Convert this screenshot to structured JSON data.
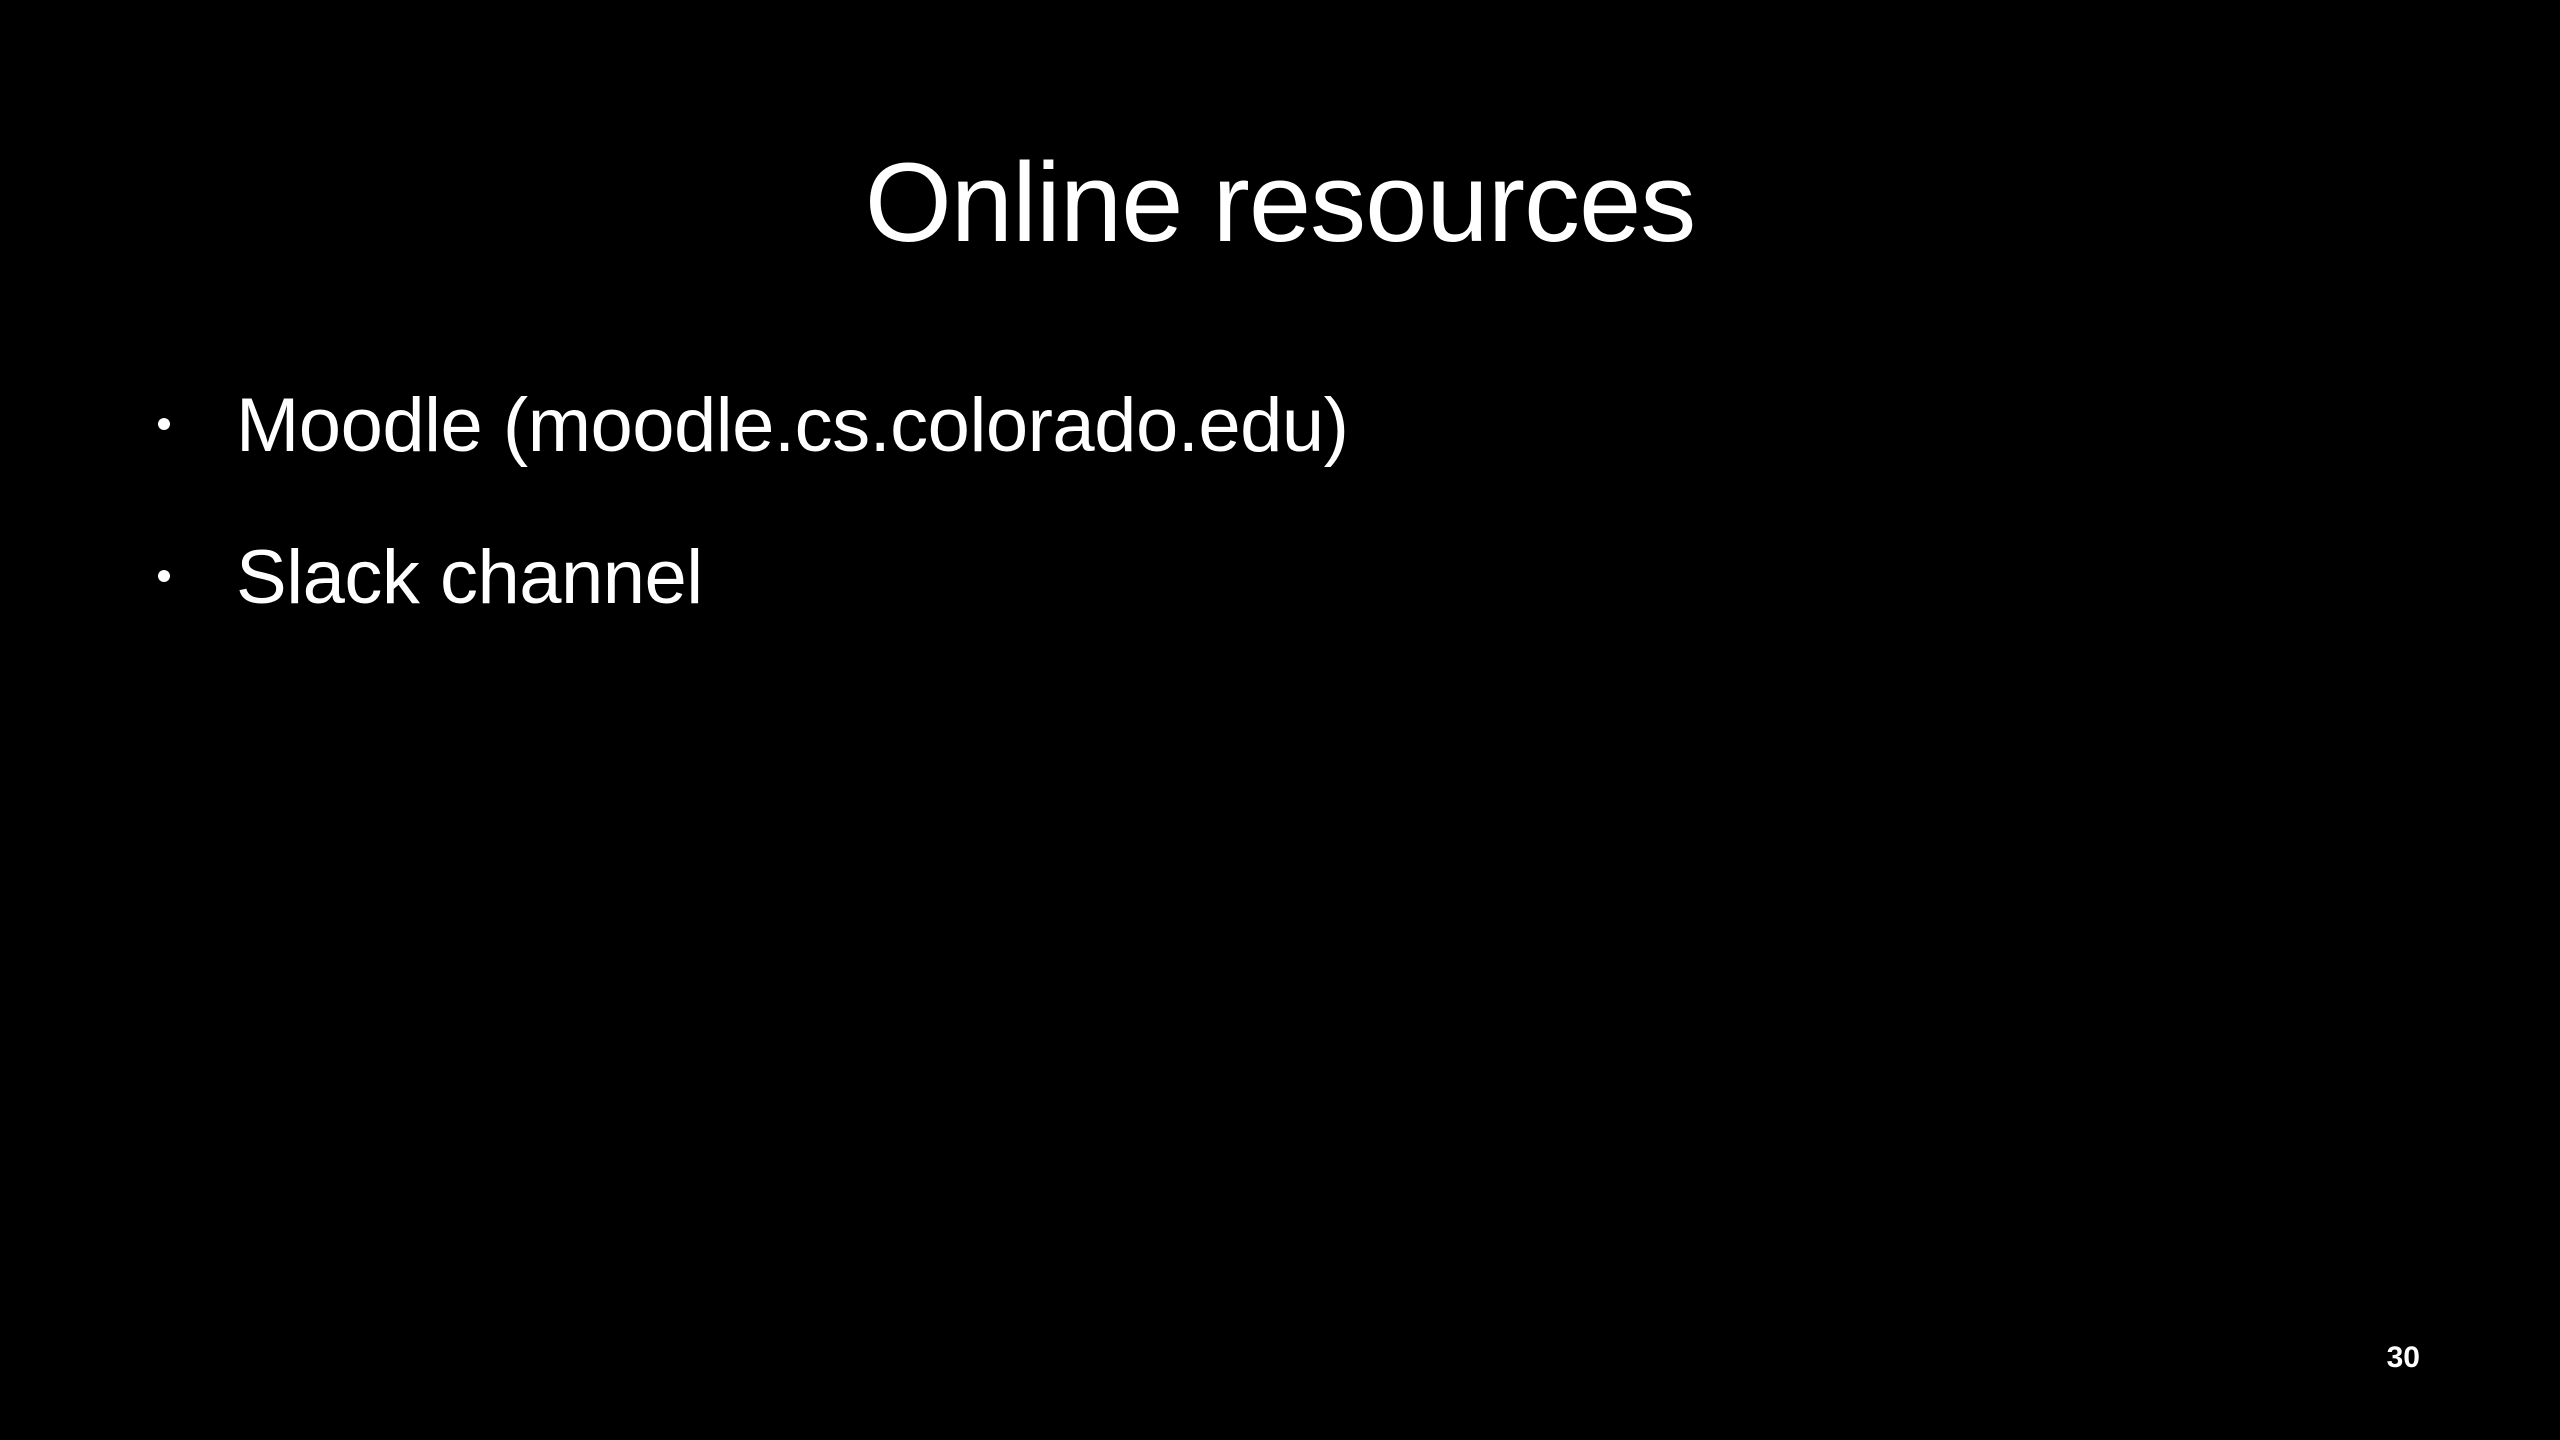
{
  "slide": {
    "title": "Online resources",
    "bullets": [
      {
        "text": "Moodle (moodle.cs.colorado.edu)"
      },
      {
        "text": "Slack channel"
      }
    ],
    "page_number": "30",
    "colors": {
      "background": "#000000",
      "text": "#ffffff"
    }
  }
}
